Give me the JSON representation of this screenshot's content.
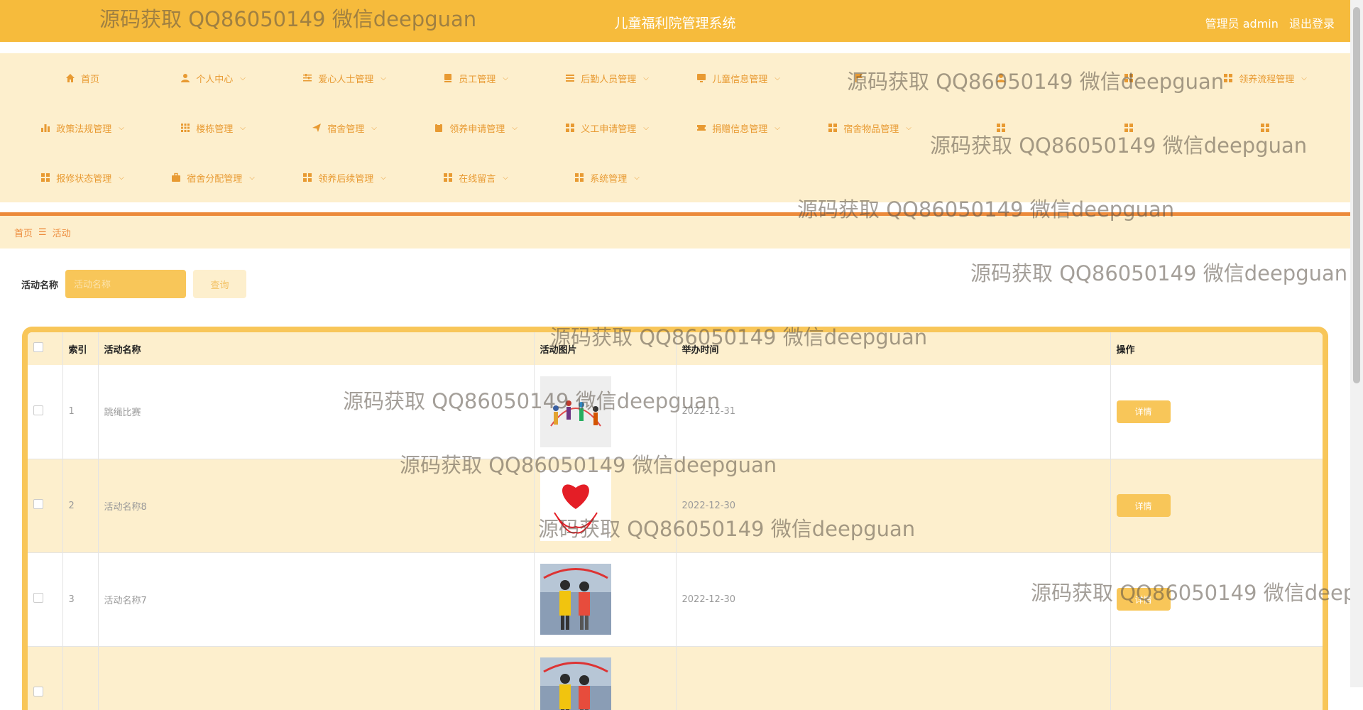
{
  "header": {
    "title": "儿童福利院管理系统",
    "user_label": "管理员 admin",
    "logout": "退出登录"
  },
  "menu": {
    "row1": [
      {
        "label": "首页",
        "icon": "home-icon",
        "chevron": false
      },
      {
        "label": "个人中心",
        "icon": "user-icon",
        "chevron": true
      },
      {
        "label": "爱心人士管理",
        "icon": "sliders-icon",
        "chevron": true
      },
      {
        "label": "员工管理",
        "icon": "book-icon",
        "chevron": true
      },
      {
        "label": "后勤人员管理",
        "icon": "list-icon",
        "chevron": true
      },
      {
        "label": "儿童信息管理",
        "icon": "monitor-icon",
        "chevron": true
      },
      {
        "label": "",
        "icon": "flag-icon",
        "chevron": false
      },
      {
        "label": "",
        "icon": "user-icon",
        "chevron": false
      },
      {
        "label": "",
        "icon": "grid-icon",
        "chevron": false
      },
      {
        "label": "领养流程管理",
        "icon": "grid-icon",
        "chevron": true
      }
    ],
    "row2": [
      {
        "label": "政策法规管理",
        "icon": "bar-chart-icon",
        "chevron": true
      },
      {
        "label": "楼栋管理",
        "icon": "apps-icon",
        "chevron": true
      },
      {
        "label": "宿舍管理",
        "icon": "send-icon",
        "chevron": true
      },
      {
        "label": "领养申请管理",
        "icon": "clipboard-icon",
        "chevron": true
      },
      {
        "label": "义工申请管理",
        "icon": "grid-icon",
        "chevron": true
      },
      {
        "label": "捐赠信息管理",
        "icon": "ticket-icon",
        "chevron": true
      },
      {
        "label": "宿舍物品管理",
        "icon": "grid-icon",
        "chevron": true
      },
      {
        "label": "",
        "icon": "grid-icon",
        "chevron": false
      },
      {
        "label": "",
        "icon": "grid-icon",
        "chevron": false
      },
      {
        "label": "",
        "icon": "grid-icon",
        "chevron": false
      }
    ],
    "row3": [
      {
        "label": "报修状态管理",
        "icon": "grid-icon",
        "chevron": true
      },
      {
        "label": "宿舍分配管理",
        "icon": "briefcase-icon",
        "chevron": true
      },
      {
        "label": "领养后续管理",
        "icon": "grid-icon",
        "chevron": true
      },
      {
        "label": "在线留言",
        "icon": "grid-icon",
        "chevron": true
      },
      {
        "label": "系统管理",
        "icon": "grid-icon",
        "chevron": true
      }
    ]
  },
  "breadcrumb": {
    "home": "首页",
    "sep": "☰",
    "current": "活动"
  },
  "search": {
    "label": "活动名称",
    "placeholder": "活动名称",
    "button": "查询"
  },
  "table": {
    "headers": [
      "索引",
      "活动名称",
      "活动图片",
      "举办时间",
      "操作"
    ],
    "rows": [
      {
        "index": "1",
        "name": "跳绳比赛",
        "date": "2022-12-31",
        "action": "详情",
        "image": "jump-rope-image"
      },
      {
        "index": "2",
        "name": "活动名称8",
        "date": "2022-12-30",
        "action": "详情",
        "image": "heart-hands-image"
      },
      {
        "index": "3",
        "name": "活动名称7",
        "date": "2022-12-30",
        "action": "详情",
        "image": "people-photo-image"
      },
      {
        "index": "",
        "name": "",
        "date": "",
        "action": "",
        "image": "people-photo-image"
      }
    ]
  },
  "watermark": "源码获取 QQ86050149 微信deepguan",
  "colors": {
    "header": "#f6bb3c",
    "menu_bg": "#fdefcd",
    "accent": "#ec8a3a",
    "button": "#f8c659"
  }
}
